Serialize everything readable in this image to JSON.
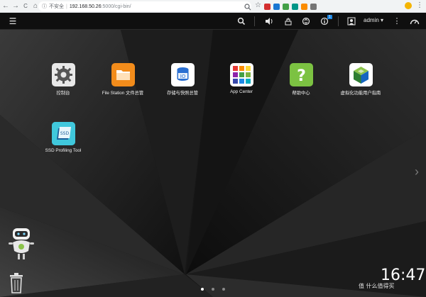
{
  "browser": {
    "security_label": "不安全",
    "url_host": "192.168.50.26",
    "url_path": ":5000/cgi-bin/",
    "back_glyph": "←",
    "forward_glyph": "→",
    "reload_glyph": "C",
    "home_glyph": "⌂",
    "ext_icons": [
      {
        "name": "extension-red-icon",
        "color": "#d32f2f"
      },
      {
        "name": "extension-blue-icon",
        "color": "#1976d2"
      },
      {
        "name": "extension-green-icon",
        "color": "#43a047"
      },
      {
        "name": "extension-teal-icon",
        "color": "#009688"
      },
      {
        "name": "extension-orange-icon",
        "color": "#fb8c00"
      },
      {
        "name": "extension-gray-icon",
        "color": "#757575"
      }
    ]
  },
  "topbar": {
    "menu_glyph": "☰",
    "user": "admin ▾",
    "notification_count": "1"
  },
  "apps": [
    {
      "label": "控制台",
      "icon": "gear-icon"
    },
    {
      "label": "File Station 文件总管",
      "icon": "folder-icon"
    },
    {
      "label": "存储与快照总管",
      "icon": "storage-icon"
    },
    {
      "label": "App Center",
      "icon": "app-grid-icon"
    },
    {
      "label": "帮助中心",
      "icon": "help-icon"
    },
    {
      "label": "虚拟化功能用户指南",
      "icon": "cube-icon"
    },
    {
      "label": "SSD Profiling Tool",
      "icon": "ssd-icon"
    }
  ],
  "clock": "16:47",
  "watermark": "值 什么值得买",
  "pager": {
    "pages": 3,
    "active": 0
  },
  "colors": {
    "accent": "#1e88e5",
    "bar": "#0f0f0f"
  }
}
